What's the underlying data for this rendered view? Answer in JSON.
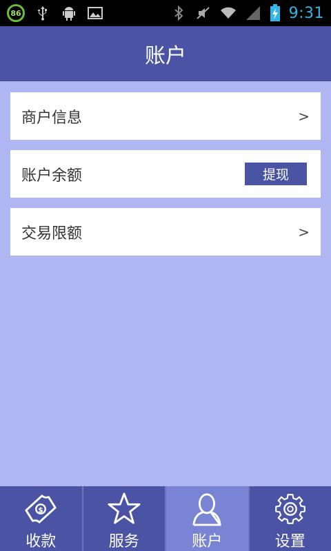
{
  "status_bar": {
    "battery_badge": "86",
    "time": "9:31",
    "left_icons": [
      "battery-percent-icon",
      "usb-icon",
      "android-debug-icon",
      "image-icon"
    ],
    "right_icons": [
      "bluetooth-icon",
      "mute-icon",
      "wifi-icon",
      "signal-icon",
      "battery-charging-icon"
    ]
  },
  "header": {
    "title": "账户"
  },
  "list": {
    "items": [
      {
        "label": "商户信息",
        "arrow": ">"
      },
      {
        "label": "账户余额",
        "button": "提现"
      },
      {
        "label": "交易限额",
        "arrow": ">"
      }
    ]
  },
  "bottom_nav": {
    "items": [
      {
        "label": "收款",
        "icon": "payment-note-icon"
      },
      {
        "label": "服务",
        "icon": "star-icon"
      },
      {
        "label": "账户",
        "icon": "user-icon",
        "active": true
      },
      {
        "label": "设置",
        "icon": "gear-icon"
      }
    ]
  },
  "colors": {
    "primary": "#4b53a5",
    "background": "#b0b6f2",
    "active_tab": "#7a84d4",
    "clock": "#33b5e5"
  }
}
